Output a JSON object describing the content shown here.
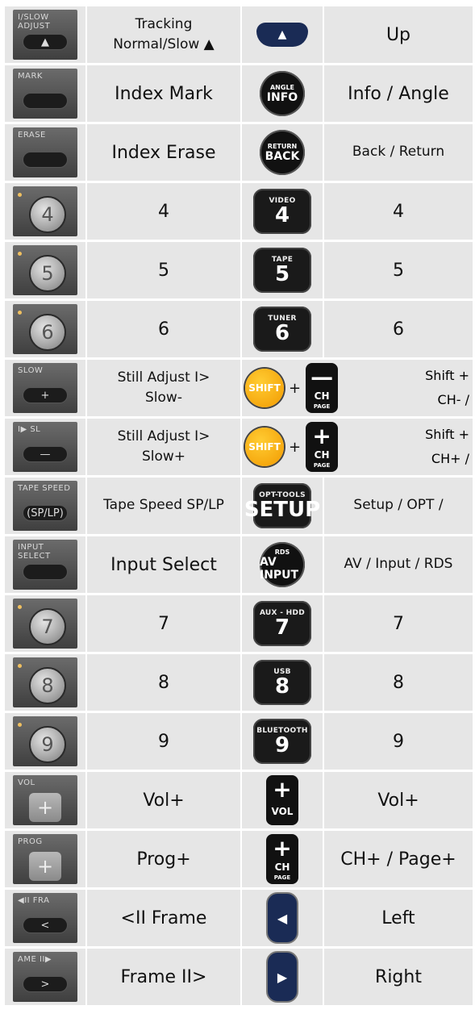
{
  "rows": [
    {
      "left_img": {
        "label": "I/SLOW\nADJUST",
        "key": "▲"
      },
      "left_text": [
        "Tracking",
        "Normal/Slow ▲"
      ],
      "right_img": {
        "type": "nav-up",
        "glyph": "▲"
      },
      "right_text": [
        "Up"
      ]
    },
    {
      "left_img": {
        "label": "MARK",
        "key": ""
      },
      "left_text": [
        "Index Mark"
      ],
      "right_img": {
        "type": "circ",
        "top": "ANGLE",
        "main": "INFO"
      },
      "right_text": [
        "Info / Angle"
      ]
    },
    {
      "left_img": {
        "label": "ERASE",
        "key": ""
      },
      "left_text": [
        "Index Erase"
      ],
      "right_img": {
        "type": "circ",
        "top": "RETURN",
        "main": "BACK"
      },
      "right_text": [
        "Back / Return"
      ]
    },
    {
      "left_img": {
        "round": "4"
      },
      "left_text": [
        "4"
      ],
      "right_img": {
        "type": "btn",
        "top": "VIDEO",
        "main": "4"
      },
      "right_text": [
        "4"
      ]
    },
    {
      "left_img": {
        "round": "5"
      },
      "left_text": [
        "5"
      ],
      "right_img": {
        "type": "btn",
        "top": "TAPE",
        "main": "5"
      },
      "right_text": [
        "5"
      ]
    },
    {
      "left_img": {
        "round": "6"
      },
      "left_text": [
        "6"
      ],
      "right_img": {
        "type": "btn",
        "top": "TUNER",
        "main": "6"
      },
      "right_text": [
        "6"
      ]
    },
    {
      "left_img": {
        "label": "SLOW",
        "key": "+"
      },
      "left_text": [
        "Still Adjust I>",
        "Slow-"
      ],
      "right_combo": {
        "shift": "SHIFT",
        "plus": "+",
        "rocker": {
          "sym": "—",
          "cap": "CH",
          "sub": "PAGE"
        },
        "text": [
          "Shift +",
          "CH- /"
        ]
      }
    },
    {
      "left_img": {
        "label": "I▶ SL",
        "key": "—"
      },
      "left_text": [
        "Still Adjust I>",
        "Slow+"
      ],
      "right_combo": {
        "shift": "SHIFT",
        "plus": "+",
        "rocker": {
          "sym": "+",
          "cap": "CH",
          "sub": "PAGE"
        },
        "text": [
          "Shift +",
          "CH+ /"
        ]
      }
    },
    {
      "left_img": {
        "label": "TAPE SPEED",
        "key": "(SP/LP)"
      },
      "left_text": [
        "Tape Speed SP/LP"
      ],
      "right_img": {
        "type": "btn",
        "top": "OPT-TOOLS",
        "main": "SETUP"
      },
      "right_text": [
        "Setup / OPT /"
      ]
    },
    {
      "left_img": {
        "label": "INPUT SELECT",
        "key": ""
      },
      "left_text": [
        "Input Select"
      ],
      "right_img": {
        "type": "circ",
        "top": "RDS",
        "main": "AV INPUT"
      },
      "right_text": [
        "AV / Input / RDS"
      ]
    },
    {
      "left_img": {
        "round": "7"
      },
      "left_text": [
        "7"
      ],
      "right_img": {
        "type": "btn",
        "top": "AUX - HDD",
        "main": "7"
      },
      "right_text": [
        "7"
      ]
    },
    {
      "left_img": {
        "round": "8"
      },
      "left_text": [
        "8"
      ],
      "right_img": {
        "type": "btn",
        "top": "USB",
        "main": "8"
      },
      "right_text": [
        "8"
      ]
    },
    {
      "left_img": {
        "round": "9"
      },
      "left_text": [
        "9"
      ],
      "right_img": {
        "type": "btn",
        "top": "BLUETOOTH",
        "main": "9"
      },
      "right_text": [
        "9"
      ]
    },
    {
      "left_img": {
        "sq_label": "VOL",
        "sq": "+"
      },
      "left_text": [
        "Vol+"
      ],
      "right_img": {
        "type": "rocker",
        "sym": "+",
        "cap": "VOL",
        "sub": ""
      },
      "right_text": [
        "Vol+"
      ]
    },
    {
      "left_img": {
        "sq_label": "PROG",
        "sq": "+"
      },
      "left_text": [
        "Prog+"
      ],
      "right_img": {
        "type": "rocker",
        "sym": "+",
        "cap": "CH",
        "sub": "PAGE"
      },
      "right_text": [
        "CH+ / Page+"
      ]
    },
    {
      "left_img": {
        "label": "◀II FRA",
        "key": "<"
      },
      "left_text": [
        "<II Frame"
      ],
      "right_img": {
        "type": "nav-side",
        "glyph": "◀"
      },
      "right_text": [
        "Left"
      ]
    },
    {
      "left_img": {
        "label": "AME II▶",
        "key": ">"
      },
      "left_text": [
        "Frame II>"
      ],
      "right_img": {
        "type": "nav-side",
        "glyph": "▶"
      },
      "right_text": [
        "Right"
      ]
    }
  ]
}
